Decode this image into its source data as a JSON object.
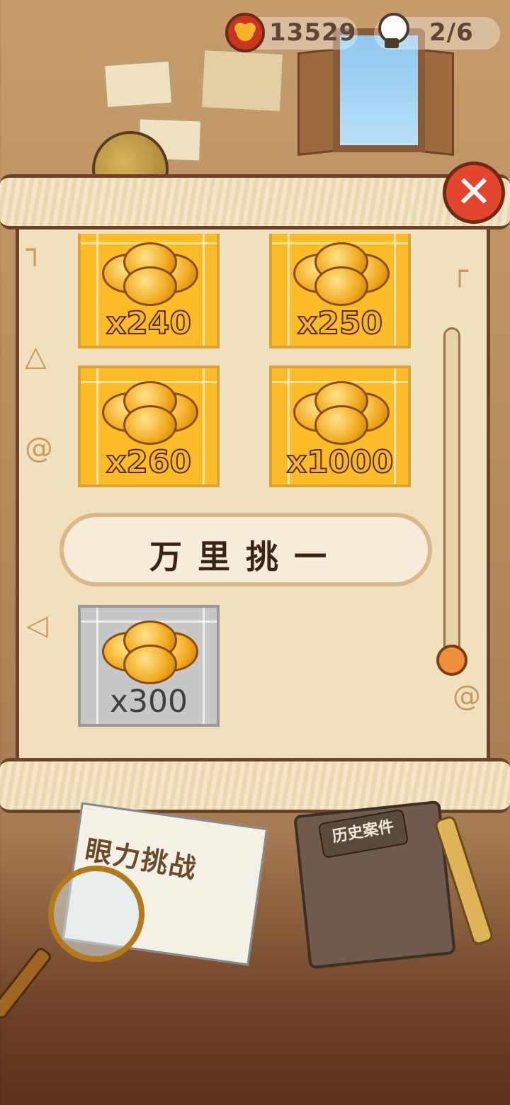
{
  "hud": {
    "coin_count": "13529",
    "hint_count": "2/6"
  },
  "panel": {
    "close_label": "✕",
    "banner_title": "万里挑一",
    "rewards_top": [
      {
        "amount": "x240",
        "style": "gold"
      },
      {
        "amount": "x250",
        "style": "gold"
      },
      {
        "amount": "x260",
        "style": "gold"
      },
      {
        "amount": "x1000",
        "style": "gold"
      }
    ],
    "rewards_bottom": [
      {
        "amount": "x300",
        "style": "silver"
      }
    ]
  },
  "desk": {
    "card_title": "眼力挑战",
    "book_title": "历史案件"
  },
  "colors": {
    "accent_gold": "#fbbc26",
    "close_red": "#e2462c",
    "scroll_thumb": "#f08f3a"
  }
}
